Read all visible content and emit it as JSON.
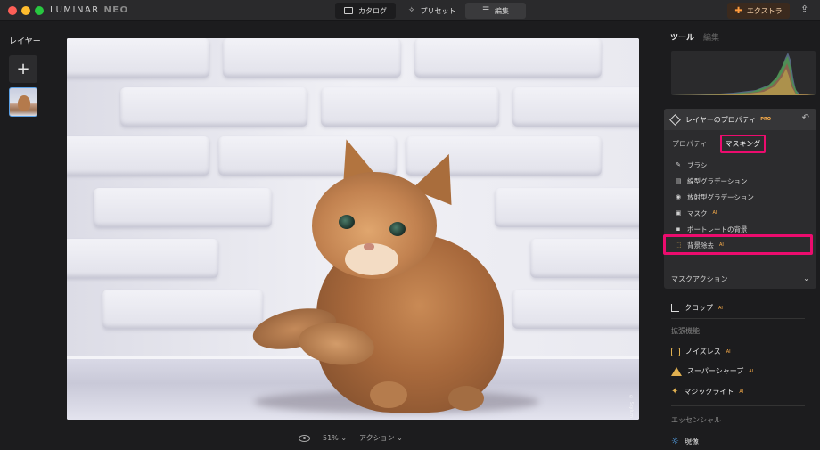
{
  "app": {
    "logo_main": "LUMINAR",
    "logo_neo": "NEO"
  },
  "topnav": {
    "catalog": "カタログ",
    "presets": "プリセット",
    "edit": "編集",
    "extra": "エクストラ"
  },
  "layers": {
    "title": "レイヤー",
    "add_label": "+"
  },
  "canvas": {
    "watermark": "© Skylum"
  },
  "bottombar": {
    "zoom": "51%",
    "actions": "アクション"
  },
  "right": {
    "tab_tools": "ツール",
    "tab_edit": "編集",
    "props_title": "レイヤーのプロパティ",
    "props_pro": "PRO",
    "subtab_properties": "プロパティ",
    "subtab_masking": "マスキング",
    "tools": [
      {
        "label": "ブラシ",
        "ai": ""
      },
      {
        "label": "線型グラデーション",
        "ai": ""
      },
      {
        "label": "放射型グラデーション",
        "ai": ""
      },
      {
        "label": "マスク",
        "ai": "AI"
      },
      {
        "label": "ポートレートの背景",
        "ai": ""
      },
      {
        "label": "背景除去",
        "ai": "AI"
      }
    ],
    "mask_action": "マスクアクション",
    "crop": "クロップ",
    "crop_ai": "AI",
    "extensions_label": "拡張機能",
    "noiseless": "ノイズレス",
    "noiseless_ai": "AI",
    "supersharp": "スーパーシャープ",
    "supersharp_ai": "AI",
    "magiclight": "マジックライト",
    "magiclight_ai": "AI",
    "essentials_label": "エッセンシャル",
    "develop": "現像"
  },
  "colors": {
    "highlight": "#ec0c6e",
    "pro_accent": "#ffb04a",
    "selection_blue": "#5aa0e6"
  }
}
